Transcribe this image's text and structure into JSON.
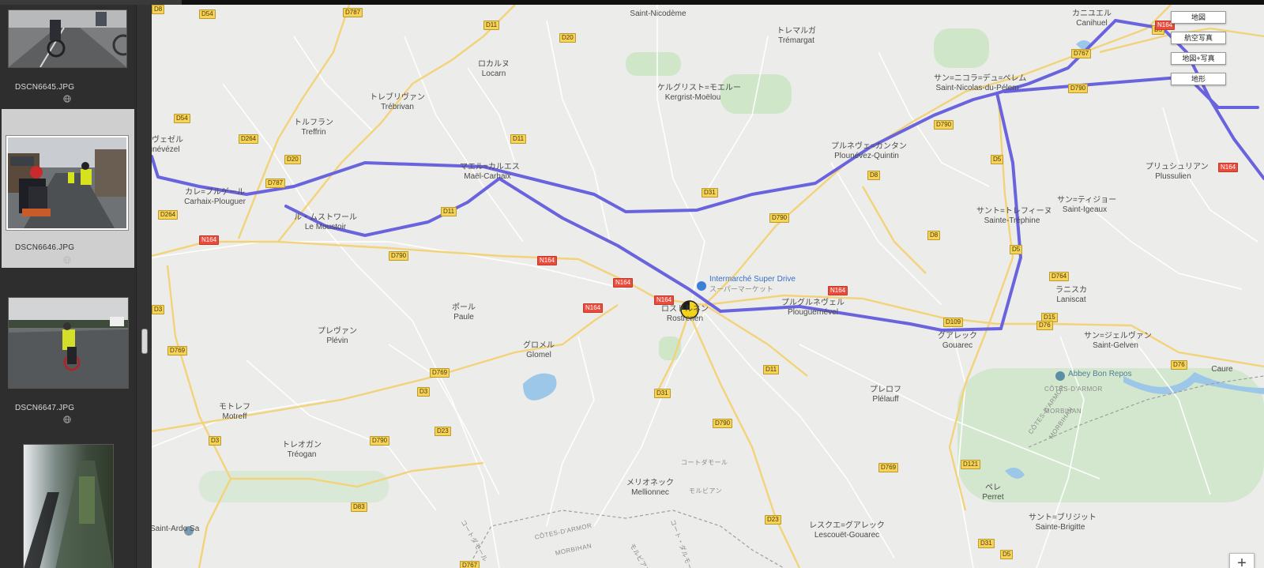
{
  "thumbnails": [
    {
      "filename": "DSCN6645.JPG",
      "selected": false
    },
    {
      "filename": "DSCN6646.JPG",
      "selected": true
    },
    {
      "filename": "DSCN6647.JPG",
      "selected": false
    },
    {
      "filename": "",
      "selected": false
    }
  ],
  "map_type_buttons": [
    "地図",
    "航空写真",
    "地図+写真",
    "地形"
  ],
  "zoom_in_label": "+",
  "route_color": "#6a63de",
  "marker_color": "#f5d31a",
  "map_labels": {
    "places": [
      {
        "jp": "ルネヴェゼル",
        "fr": "Lounévézel"
      },
      {
        "jp": "カレ=ブルゲール",
        "fr": "Carhaix-Plouguer"
      },
      {
        "jp": "トルフラン",
        "fr": "Treffrin"
      },
      {
        "jp": "トレブリヴァン",
        "fr": "Trébrivan"
      },
      {
        "jp": "ロカルヌ",
        "fr": "Locarn"
      },
      {
        "jp": "",
        "fr": "Saint-Nicodème"
      },
      {
        "jp": "トレマルガ",
        "fr": "Trémargat"
      },
      {
        "jp": "ケルグリスト=モエルー",
        "fr": "Kergrist-Moëlou"
      },
      {
        "jp": "マエル=カルエス",
        "fr": "Maël-Carhaix"
      },
      {
        "jp": "ル・ムストワール",
        "fr": "Le Moustoir"
      },
      {
        "jp": "プルネヴェ=カンタン",
        "fr": "Plounévez-Quintin"
      },
      {
        "jp": "サン=ニコラ=デュ=ペレム",
        "fr": "Saint-Nicolas-du-Pélem"
      },
      {
        "jp": "カニユエル",
        "fr": "Canihuel"
      },
      {
        "jp": "プリュシュリアン",
        "fr": "Plussulien"
      },
      {
        "jp": "サン=ティジョー",
        "fr": "Saint-Igeaux"
      },
      {
        "jp": "サント=トレフィーヌ",
        "fr": "Sainte-Tréphine"
      },
      {
        "jp": "ロストルネン",
        "fr": "Rostrenen"
      },
      {
        "jp": "プルグルネヴェル",
        "fr": "Plouguernével"
      },
      {
        "jp": "グアレック",
        "fr": "Gouarec"
      },
      {
        "jp": "ラニスカ",
        "fr": "Laniscat"
      },
      {
        "jp": "サン=ジェルヴァン",
        "fr": "Saint-Gelven"
      },
      {
        "jp": "ポール",
        "fr": "Paule"
      },
      {
        "jp": "プレヴァン",
        "fr": "Plévin"
      },
      {
        "jp": "グロメル",
        "fr": "Glomel"
      },
      {
        "jp": "プレロフ",
        "fr": "Plélauff"
      },
      {
        "jp": "モトレフ",
        "fr": "Motreff"
      },
      {
        "jp": "トレオガン",
        "fr": "Tréogan"
      },
      {
        "jp": "メリオネック",
        "fr": "Mellionnec"
      },
      {
        "jp": "ペレ",
        "fr": "Perret"
      },
      {
        "jp": "サント=ブリジット",
        "fr": "Sainte-Brigitte"
      },
      {
        "jp": "レスクエ=グアレック",
        "fr": "Lescouët-Gouarec"
      },
      {
        "jp": "",
        "fr": "Saint-Ardo Sa"
      },
      {
        "jp": "",
        "fr": "Caure"
      }
    ],
    "poi": [
      {
        "name": "Intermarché Super Drive",
        "sub": "スーパーマーケット"
      },
      {
        "name": "Abbey Bon Repos",
        "sub": ""
      }
    ],
    "roads": [
      "D54",
      "D787",
      "D11",
      "D20",
      "D54",
      "D264",
      "D264",
      "N164",
      "D787",
      "D20",
      "D11",
      "D11",
      "D31",
      "D790",
      "D8",
      "D5",
      "D790",
      "D790",
      "D5",
      "D8",
      "D5",
      "D767",
      "D790",
      "N164",
      "N164",
      "N164",
      "N164",
      "N164",
      "D3",
      "D769",
      "D769",
      "D3",
      "D11",
      "D31",
      "D790",
      "D23",
      "D23",
      "D790",
      "D3",
      "D83",
      "D769",
      "D121",
      "D31",
      "D5",
      "D764",
      "D15",
      "D76",
      "D76",
      "N164",
      "N164",
      "D767",
      "D109",
      "D8"
    ],
    "regions": [
      "CÔTES-D'ARMOR",
      "MORBIHAN",
      "CÔTES-D'ARMOR",
      "MORBIHAN",
      "CÔTES-D'ARMOR",
      "MORBIHAN",
      "モルビアン",
      "コート・ダルモール",
      "コートダモール",
      "モルビアン",
      "コートダモール"
    ]
  }
}
